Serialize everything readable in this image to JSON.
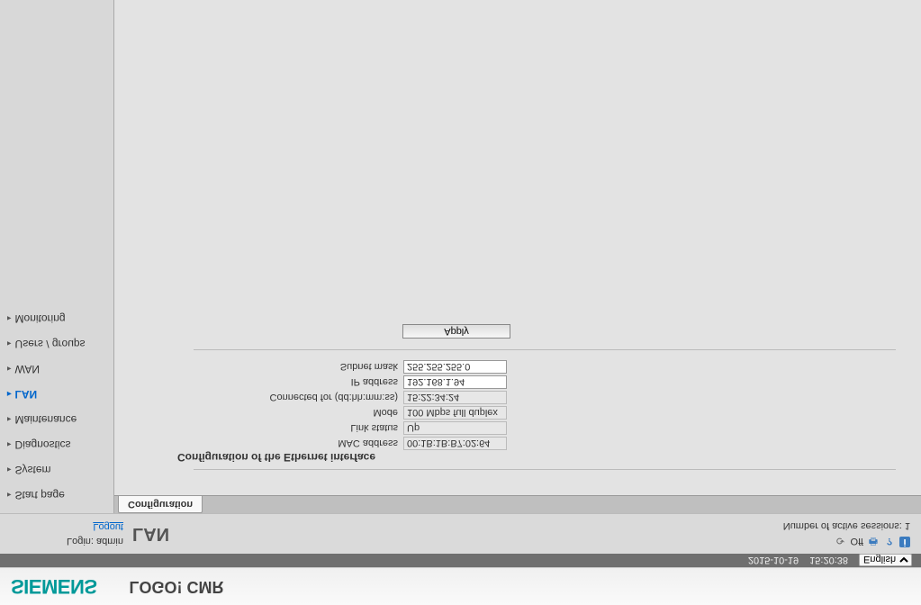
{
  "brand": "SIEMENS",
  "product": "LOGO! CMR",
  "datetime": {
    "date": "2015-10-19",
    "time": "15:20:38"
  },
  "language": {
    "options": [
      "English"
    ],
    "selected": "English"
  },
  "icons": {
    "refresh": "⟳",
    "off_label": "Off",
    "printer": "🖶",
    "help": "?",
    "info": "i"
  },
  "sessions_label": "Number of active sessions: ",
  "sessions_count": "1",
  "page_title": "LAN",
  "login_label": "Login: ",
  "login_user": "admin",
  "logout_label": "Logout",
  "nav": [
    {
      "id": "start",
      "label": "Start page",
      "active": false
    },
    {
      "id": "system",
      "label": "System",
      "active": false
    },
    {
      "id": "diagnostics",
      "label": "Diagnostics",
      "active": false
    },
    {
      "id": "maintenance",
      "label": "Maintenance",
      "active": false
    },
    {
      "id": "lan",
      "label": "LAN",
      "active": true
    },
    {
      "id": "wan",
      "label": "WAN",
      "active": false
    },
    {
      "id": "users",
      "label": "Users / groups",
      "active": false
    },
    {
      "id": "monitoring",
      "label": "Monitoring",
      "active": false
    }
  ],
  "tabs": [
    {
      "id": "config",
      "label": "Configuration",
      "active": true
    }
  ],
  "section_heading": "Configuration of the Ethernet interface",
  "fields": {
    "mac_label": "MAC address",
    "mac_value": "00:1B:1B:B7:02:64",
    "link_label": "Link status",
    "link_value": "Up",
    "mode_label": "Mode",
    "mode_value": "100 Mbps full duplex",
    "connfor_label": "Connected for (dd:hh:mm:ss)",
    "connfor_value": "15:22:34:24",
    "ip_label": "IP address",
    "ip_value": "192.168.1.94",
    "mask_label": "Subnet mask",
    "mask_value": "255.255.255.0"
  },
  "apply_label": "Apply"
}
